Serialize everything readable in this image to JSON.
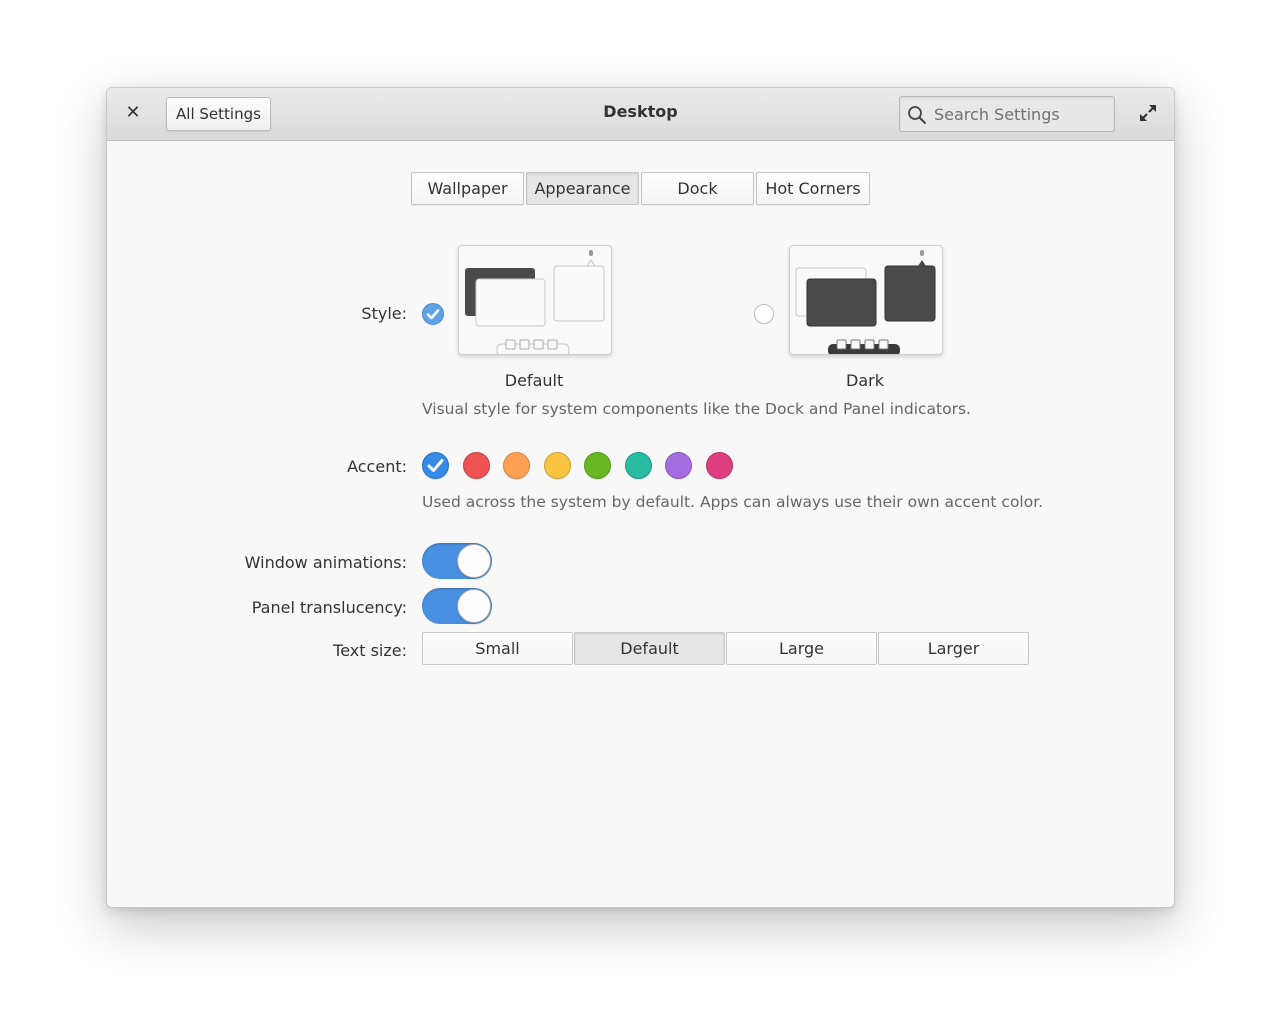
{
  "window": {
    "title": "Desktop",
    "all_settings_label": "All Settings",
    "search_placeholder": "Search Settings"
  },
  "tabs": [
    {
      "label": "Wallpaper",
      "active": false
    },
    {
      "label": "Appearance",
      "active": true
    },
    {
      "label": "Dock",
      "active": false
    },
    {
      "label": "Hot Corners",
      "active": false
    }
  ],
  "style": {
    "label": "Style:",
    "options": [
      {
        "label": "Default",
        "selected": true
      },
      {
        "label": "Dark",
        "selected": false
      }
    ],
    "description": "Visual style for system components like the Dock and Panel indicators."
  },
  "accent": {
    "label": "Accent:",
    "colors": [
      {
        "name": "blue",
        "hex": "#3689e6",
        "selected": true
      },
      {
        "name": "red",
        "hex": "#ed5353",
        "selected": false
      },
      {
        "name": "orange",
        "hex": "#ffa154",
        "selected": false
      },
      {
        "name": "yellow",
        "hex": "#f9c440",
        "selected": false
      },
      {
        "name": "green",
        "hex": "#68b723",
        "selected": false
      },
      {
        "name": "mint",
        "hex": "#28bca3",
        "selected": false
      },
      {
        "name": "purple",
        "hex": "#a56de2",
        "selected": false
      },
      {
        "name": "pink",
        "hex": "#de3e80",
        "selected": false
      }
    ],
    "description": "Used across the system by default. Apps can always use their own accent color."
  },
  "window_animations": {
    "label": "Window animations:",
    "on": true
  },
  "panel_translucency": {
    "label": "Panel translucency:",
    "on": true
  },
  "text_size": {
    "label": "Text size:",
    "options": [
      {
        "label": "Small",
        "active": false
      },
      {
        "label": "Default",
        "active": true
      },
      {
        "label": "Large",
        "active": false
      },
      {
        "label": "Larger",
        "active": false
      }
    ]
  }
}
